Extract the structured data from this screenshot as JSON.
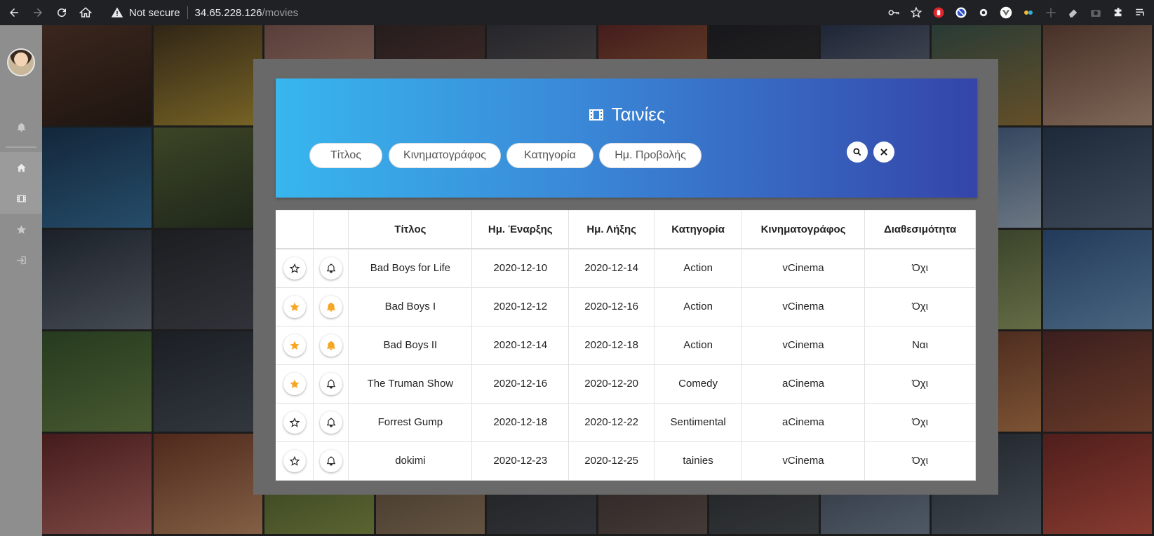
{
  "browser": {
    "security_label": "Not secure",
    "url_host": "34.65.228.126",
    "url_path": "/movies"
  },
  "sidebar": {
    "items": [
      {
        "icon": "bell-icon"
      },
      {
        "icon": "home-icon"
      },
      {
        "icon": "film-icon"
      },
      {
        "icon": "star-icon"
      },
      {
        "icon": "logout-icon"
      }
    ]
  },
  "header": {
    "title": "Ταινίες",
    "filters": [
      "Τίτλος",
      "Κινηματογράφος",
      "Κατηγορία",
      "Ημ. Προβολής"
    ]
  },
  "table": {
    "columns": [
      "Τίτλος",
      "Ημ. Έναρξης",
      "Ημ. Λήξης",
      "Κατηγορία",
      "Κινηματογράφος",
      "Διαθεσιμότητα"
    ],
    "rows": [
      {
        "favorite": false,
        "notify": false,
        "title": "Bad Boys for Life",
        "start": "2020-12-10",
        "end": "2020-12-14",
        "category": "Action",
        "cinema": "vCinema",
        "availability": "Όχι"
      },
      {
        "favorite": true,
        "notify": true,
        "title": "Bad Boys I",
        "start": "2020-12-12",
        "end": "2020-12-16",
        "category": "Action",
        "cinema": "vCinema",
        "availability": "Όχι"
      },
      {
        "favorite": true,
        "notify": true,
        "title": "Bad Boys II",
        "start": "2020-12-14",
        "end": "2020-12-18",
        "category": "Action",
        "cinema": "vCinema",
        "availability": "Ναι"
      },
      {
        "favorite": true,
        "notify": false,
        "title": "The Truman Show",
        "start": "2020-12-16",
        "end": "2020-12-20",
        "category": "Comedy",
        "cinema": "aCinema",
        "availability": "Όχι"
      },
      {
        "favorite": false,
        "notify": false,
        "title": "Forrest Gump",
        "start": "2020-12-18",
        "end": "2020-12-22",
        "category": "Sentimental",
        "cinema": "aCinema",
        "availability": "Όχι"
      },
      {
        "favorite": false,
        "notify": false,
        "title": "dokimi",
        "start": "2020-12-23",
        "end": "2020-12-25",
        "category": "tainies",
        "cinema": "vCinema",
        "availability": "Όχι"
      }
    ]
  },
  "colors": {
    "accent_active": "#f6a623",
    "header_gradient_start": "#38b6ee",
    "header_gradient_end": "#3445a9"
  }
}
